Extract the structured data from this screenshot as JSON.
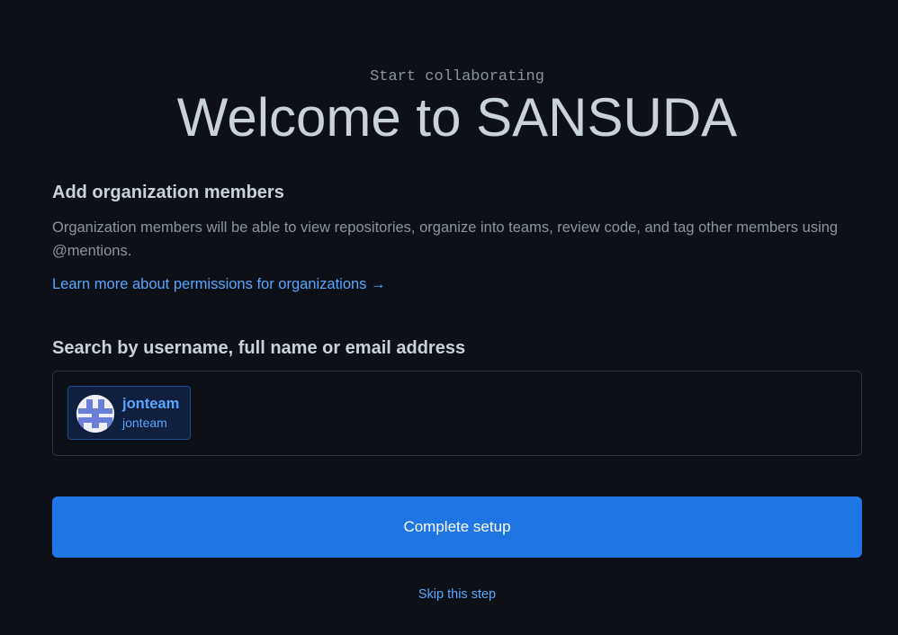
{
  "header": {
    "eyebrow": "Start collaborating",
    "title": "Welcome to SANSUDA"
  },
  "members_section": {
    "title": "Add organization members",
    "description": "Organization members will be able to view repositories, organize into teams, review code, and tag other members using @mentions.",
    "learn_more_link": "Learn more about permissions for organizations →"
  },
  "search": {
    "label": "Search by username, full name or email address",
    "selected_members": [
      {
        "login": "jonteam",
        "name": "jonteam",
        "avatar_icon": "identicon-avatar"
      }
    ]
  },
  "actions": {
    "complete_label": "Complete setup",
    "skip_label": "Skip this step"
  },
  "colors": {
    "background": "#0d1117",
    "primary_button": "#1f75e3",
    "link": "#58a6ff",
    "avatar_pattern": "#6a7fd8"
  }
}
